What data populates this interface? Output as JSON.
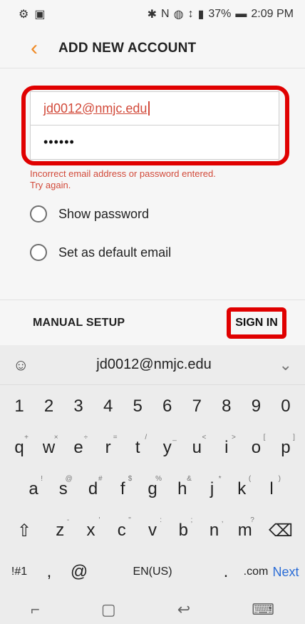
{
  "status": {
    "left_icons": [
      "settings-icon",
      "image-icon"
    ],
    "right_icons": [
      "bluetooth-icon",
      "nfc-icon",
      "do-not-disturb-icon",
      "data-icon",
      "signal-icon"
    ],
    "battery": "37%",
    "time": "2:09 PM"
  },
  "header": {
    "title": "ADD NEW ACCOUNT"
  },
  "form": {
    "email": "jd0012@nmjc.edu",
    "password_mask": "••••••",
    "error_line1": "Incorrect email address or password entered.",
    "error_line2": "Try again.",
    "show_password": "Show password",
    "set_default": "Set as default email"
  },
  "actions": {
    "manual_setup": "MANUAL SETUP",
    "sign_in": "SIGN IN"
  },
  "keyboard": {
    "suggestion": "jd0012@nmjc.edu",
    "row1": [
      "1",
      "2",
      "3",
      "4",
      "5",
      "6",
      "7",
      "8",
      "9",
      "0"
    ],
    "row2": [
      "q",
      "w",
      "e",
      "r",
      "t",
      "y",
      "u",
      "i",
      "o",
      "p"
    ],
    "row2_sup": [
      "+",
      "×",
      "÷",
      "=",
      "/",
      "_",
      "<",
      ">",
      "[",
      "]"
    ],
    "row3": [
      "a",
      "s",
      "d",
      "f",
      "g",
      "h",
      "j",
      "k",
      "l"
    ],
    "row3_sup": [
      "!",
      "@",
      "#",
      "$",
      "%",
      "&",
      "*",
      "(",
      ")"
    ],
    "row4": [
      "z",
      "x",
      "c",
      "v",
      "b",
      "n",
      "m"
    ],
    "row4_sup": [
      "-",
      "'",
      "\"",
      ":",
      ";",
      ",",
      "?"
    ],
    "row5": {
      "sym": "!#1",
      "comma": ",",
      "at": "@",
      "lang": "EN(US)",
      "dot": ".",
      "com": ".com",
      "next": "Next"
    }
  }
}
